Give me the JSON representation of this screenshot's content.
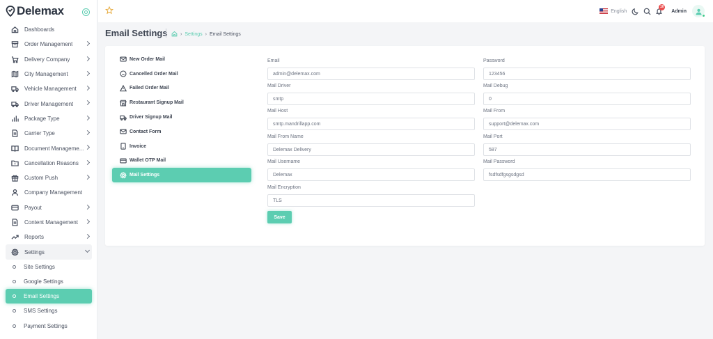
{
  "brand": {
    "name": "Delemax",
    "accent": "#5ccdb1"
  },
  "sidebar": {
    "items": [
      {
        "label": "Dashboards",
        "icon": "home-icon",
        "chevron": false
      },
      {
        "label": "Order Management",
        "icon": "box-icon",
        "chevron": true
      },
      {
        "label": "Delivery Company",
        "icon": "cart-icon",
        "chevron": true
      },
      {
        "label": "City Management",
        "icon": "map-icon",
        "chevron": true
      },
      {
        "label": "Vehicle Management",
        "icon": "truck-icon",
        "chevron": true
      },
      {
        "label": "Driver Management",
        "icon": "truck-icon",
        "chevron": true
      },
      {
        "label": "Package Type",
        "icon": "bar-chart-icon",
        "chevron": true
      },
      {
        "label": "Carrier Type",
        "icon": "file-icon",
        "chevron": true
      },
      {
        "label": "Document Manageme...",
        "icon": "book-icon",
        "chevron": true
      },
      {
        "label": "Cancellation Reasons",
        "icon": "folder-icon",
        "chevron": true
      },
      {
        "label": "Custom Push",
        "icon": "gift-icon",
        "chevron": true
      },
      {
        "label": "Company Management",
        "icon": "user-icon",
        "chevron": false
      },
      {
        "label": "Payout",
        "icon": "card-icon",
        "chevron": true
      },
      {
        "label": "Content Management",
        "icon": "file-icon",
        "chevron": true
      },
      {
        "label": "Reports",
        "icon": "trend-icon",
        "chevron": true
      },
      {
        "label": "Settings",
        "icon": "gear-icon",
        "chevron": true
      }
    ],
    "settings_sub": [
      {
        "label": "Site Settings"
      },
      {
        "label": "Google Settings"
      },
      {
        "label": "Email Settings"
      },
      {
        "label": "SMS Settings"
      },
      {
        "label": "Payment Settings"
      }
    ]
  },
  "topbar": {
    "language": "English",
    "notification_count": "10",
    "user_name": "Admin"
  },
  "page": {
    "title": "Email Settings",
    "breadcrumb": {
      "parent": "Settings",
      "current": "Email Settings"
    }
  },
  "mail_templates": [
    {
      "label": "New Order Mail",
      "icon": "mail-icon"
    },
    {
      "label": "Cancelled Order Mail",
      "icon": "sad-face-icon"
    },
    {
      "label": "Failed Order Mail",
      "icon": "warning-icon"
    },
    {
      "label": "Restaurant Signup Mail",
      "icon": "store-icon"
    },
    {
      "label": "Driver Signup Mail",
      "icon": "truck-icon"
    },
    {
      "label": "Contact Form",
      "icon": "mail-icon"
    },
    {
      "label": "Invoice",
      "icon": "tablet-icon"
    },
    {
      "label": "Wallet OTP Mail",
      "icon": "card-icon"
    },
    {
      "label": "Mail Settings",
      "icon": "gear-icon"
    }
  ],
  "form": {
    "email": {
      "label": "Email",
      "value": "admin@delemax.com"
    },
    "password": {
      "label": "Password",
      "value": "123456"
    },
    "mail_driver": {
      "label": "Mail Driver",
      "value": "smtp"
    },
    "mail_debug": {
      "label": "Mail Debug",
      "value": "0"
    },
    "mail_host": {
      "label": "Mail Host",
      "value": "smtp.mandrillapp.com"
    },
    "mail_from": {
      "label": "Mail From",
      "value": "support@delemax.com"
    },
    "mail_from_name": {
      "label": "Mail From Name",
      "value": "Delemax Delivery"
    },
    "mail_port": {
      "label": "Mail Port",
      "value": "587"
    },
    "mail_username": {
      "label": "Mail Username",
      "value": "Delemax"
    },
    "mail_password": {
      "label": "Mail Password",
      "value": "fsdfsdfgsgsdgsd"
    },
    "mail_encryption": {
      "label": "Mail Encryption",
      "value": "TLS"
    },
    "save_label": "Save"
  }
}
